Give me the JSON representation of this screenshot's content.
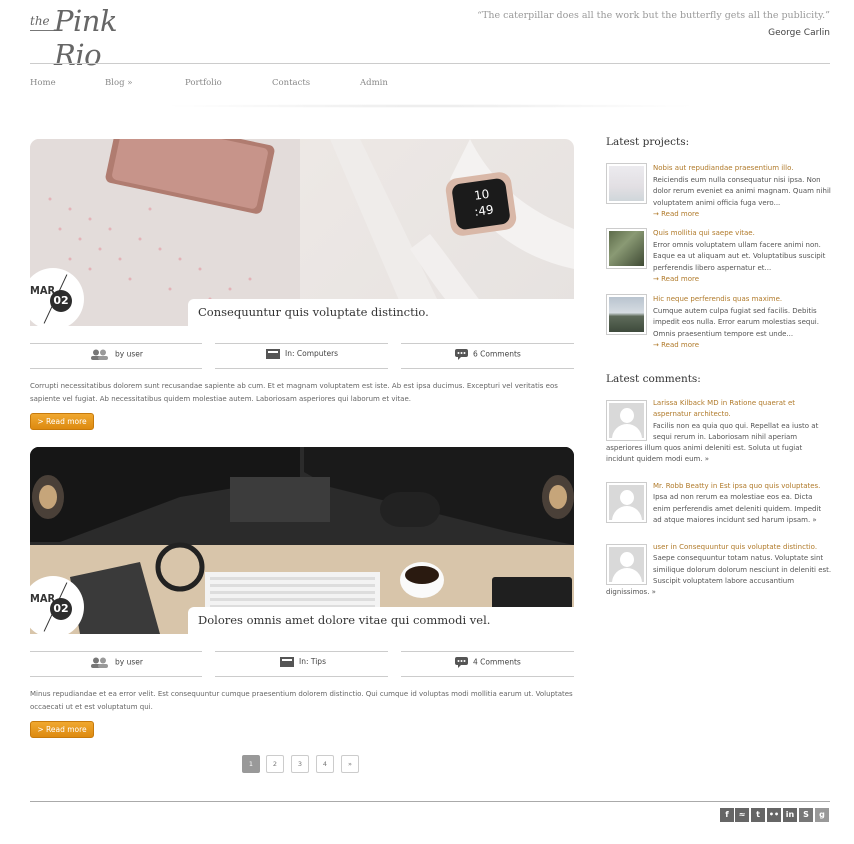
{
  "header": {
    "logo_the": "the",
    "logo_name": "Pink Rio",
    "quote": "“The caterpillar does all the work but the butterfly gets all the publicity.”",
    "author": "George Carlin"
  },
  "nav": [
    {
      "label": "Home"
    },
    {
      "label": "Blog »"
    },
    {
      "label": "Portfolio"
    },
    {
      "label": "Contacts"
    },
    {
      "label": "Admin"
    }
  ],
  "posts": [
    {
      "month": "MAR",
      "day": "02",
      "title": "Consequuntur quis voluptate distinctio.",
      "author": "by user",
      "category": "In: Computers",
      "comments": "6 Comments",
      "excerpt": "Corrupti necessitatibus dolorem sunt recusandae sapiente ab cum. Et et magnam voluptatem est iste. Ab est ipsa ducimus. Excepturi vel veritatis eos sapiente vel fugiat. Ab necessitatibus quidem molestiae autem. Laboriosam asperiores qui laborum et vitae.",
      "read_more": "> Read more"
    },
    {
      "month": "MAR",
      "day": "02",
      "title": "Dolores omnis amet dolore vitae qui commodi vel.",
      "author": "by user",
      "category": "In: Tips",
      "comments": "4 Comments",
      "excerpt": "Minus repudiandae et ea error velit. Est consequuntur cumque praesentium dolorem distinctio. Qui cumque id voluptas modi mollitia earum ut. Voluptates occaecati ut et est voluptatum qui.",
      "read_more": "> Read more"
    }
  ],
  "pagination": [
    "1",
    "2",
    "3",
    "4",
    "»"
  ],
  "pagination_active": "1",
  "sidebar": {
    "projects_heading": "Latest projects:",
    "projects": [
      {
        "title": "Nobis aut repudiandae praesentium illo.",
        "text": "Reiciendis eum nulla consequatur nisi ipsa. Non dolor rerum eveniet ea animi magnam. Quam nihil voluptatem animi officia fuga vero...",
        "more": "→ Read more"
      },
      {
        "title": "Quis mollitia qui saepe vitae.",
        "text": "Error omnis voluptatem ullam facere animi non. Eaque ea ut aliquam aut et. Voluptatibus suscipit perferendis libero aspernatur et...",
        "more": "→ Read more"
      },
      {
        "title": "Hic neque perferendis quas maxime.",
        "text": "Cumque autem culpa fugiat sed facilis. Debitis impedit eos nulla. Error earum molestias sequi. Omnis praesentium tempore est unde...",
        "more": "→ Read more"
      }
    ],
    "comments_heading": "Latest comments:",
    "comments": [
      {
        "link": "Larissa Kilback MD in Ratione quaerat et aspernatur architecto.",
        "text": "Facilis non ea quia quo qui. Repellat ea iusto at sequi rerum in. Laboriosam nihil aperiam asperiores illum quos animi deleniti est. Soluta ut fugiat incidunt quidem modi eum. »"
      },
      {
        "link": "Mr. Robb Beatty in Est ipsa quo quis voluptates.",
        "text": "Ipsa ad non rerum ea molestiae eos ea. Dicta enim perferendis amet deleniti quidem. Impedit ad atque maiores incidunt sed harum ipsam. »"
      },
      {
        "link": "user in Consequuntur quis voluptate distinctio.",
        "text": "Saepe consequuntur totam natus. Voluptate sint similique dolorum dolorum nesciunt in deleniti est. Suscipit voluptatem labore accusantium dignissimos. »"
      }
    ]
  },
  "social_icons": [
    "facebook-icon",
    "rss-icon",
    "twitter-icon",
    "flickr-icon",
    "linkedin-icon",
    "skype-icon",
    "google-plus-icon",
    "pinterest-icon"
  ],
  "social_glyphs": [
    "f",
    "≈",
    "t",
    "••",
    "in",
    "S",
    "g",
    "P"
  ],
  "colors": {
    "accent": "#b07a2a",
    "button": "#e8961e"
  }
}
